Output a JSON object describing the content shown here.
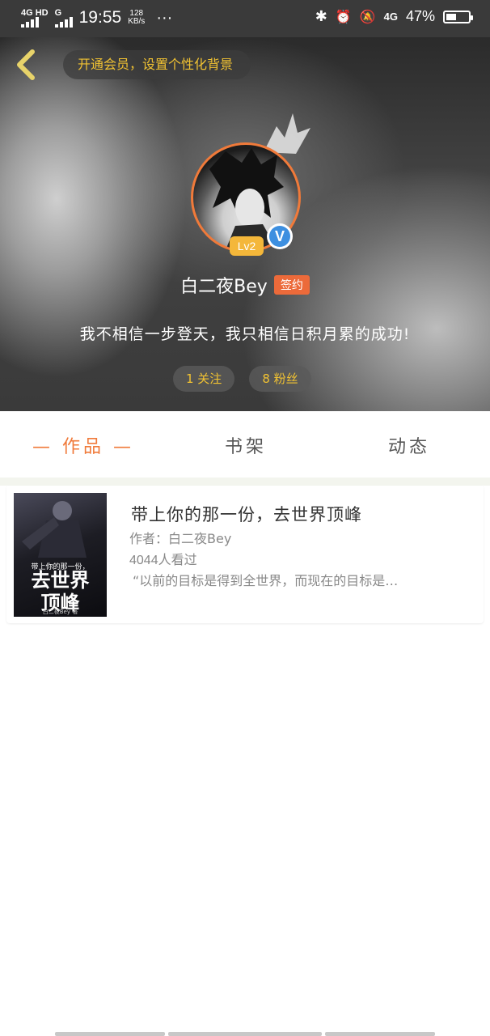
{
  "status_bar": {
    "network1": "4G HD",
    "network2": "G",
    "time": "19:55",
    "speed_value": "128",
    "speed_unit": "KB/s",
    "more": "···",
    "bt_glyph": "✱",
    "alarm_glyph": "⏰",
    "mute_glyph": "🔕",
    "network3": "4G",
    "battery": "47%",
    "battery_level": 0.47
  },
  "header": {
    "vip_tip": "开通会员，设置个性化背景"
  },
  "profile": {
    "level": "Lv2",
    "verified_mark": "V",
    "name": "白二夜Bey",
    "signed_badge": "签约",
    "bio": "我不相信一步登天，我只相信日积月累的成功!",
    "following": "1 关注",
    "followers": "8 粉丝"
  },
  "tabs": [
    {
      "label": "— 作品 —",
      "active": true
    },
    {
      "label": "书架",
      "active": false
    },
    {
      "label": "动态",
      "active": false
    }
  ],
  "works": [
    {
      "cover_line1": "带上你的那一份，",
      "cover_line2": "去世界",
      "cover_line3": "顶峰",
      "cover_author": "白二夜Bey 著",
      "title": "带上你的那一份，去世界顶峰",
      "author": "作者：白二夜Bey",
      "views": "4044人看过",
      "description": "“以前的目标是得到全世界，而现在的目标是…"
    }
  ],
  "colors": {
    "accent": "#f07a3a",
    "gold": "#f1c232",
    "verify_blue": "#3d8fe0"
  }
}
